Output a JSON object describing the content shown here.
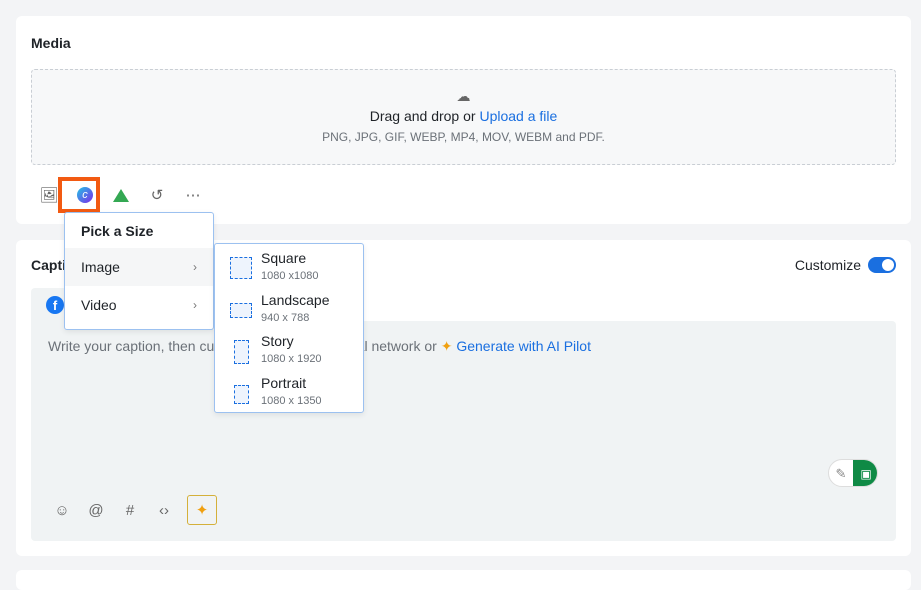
{
  "media": {
    "title": "Media",
    "drop_text": "Drag and drop or ",
    "upload_link": "Upload a file",
    "formats": "PNG, JPG, GIF, WEBP, MP4, MOV, WEBM and PDF.",
    "tools": [
      "add-image-icon",
      "canva-icon",
      "google-drive-icon",
      "history-icon",
      "more-icon"
    ]
  },
  "caption": {
    "title": "Caption",
    "customize_label": "Customize",
    "customize_on": true,
    "placeholder": "Write your caption, then customize it for each social network or ",
    "ai_link": "Generate with AI Pilot",
    "tools": [
      "emoji-icon",
      "mention-icon",
      "hashtag-icon",
      "code-icon",
      "ai-sparkle-icon"
    ]
  },
  "menu": {
    "title": "Pick a Size",
    "items": [
      {
        "label": "Image"
      },
      {
        "label": "Video"
      }
    ]
  },
  "submenu": {
    "items": [
      {
        "name": "Square",
        "dims": "1080 x1080"
      },
      {
        "name": "Landscape",
        "dims": "940 x 788"
      },
      {
        "name": "Story",
        "dims": "1080 x 1920"
      },
      {
        "name": "Portrait",
        "dims": "1080 x 1350"
      }
    ]
  },
  "colors": {
    "accent": "#1a6fe0",
    "highlight": "#f25a12",
    "bot": "#0f8a45"
  }
}
